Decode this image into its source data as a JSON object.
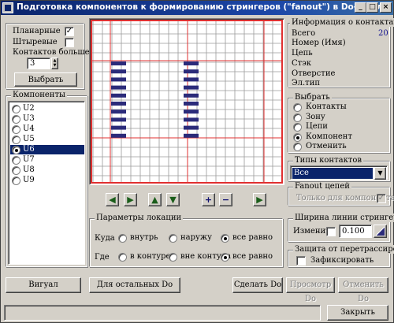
{
  "window": {
    "title": "Подготовка компонентов к формированию стрингеров (\"fanout\") в Do-файл",
    "minimize_glyph": "_",
    "maximize_glyph": "□",
    "close_glyph": "×"
  },
  "left_panel": {
    "planar_label": "Планарные",
    "planar_checked": true,
    "pin_label": "Штыревые",
    "pin_checked": false,
    "contacts_more_label": "Контактов больше",
    "contacts_more_value": "3",
    "select_button": "Выбрать",
    "components_title": "Компоненты",
    "components": [
      {
        "name": "U2",
        "selected": false
      },
      {
        "name": "U3",
        "selected": false
      },
      {
        "name": "U4",
        "selected": false
      },
      {
        "name": "U5",
        "selected": false
      },
      {
        "name": "U6",
        "selected": true
      },
      {
        "name": "U7",
        "selected": false
      },
      {
        "name": "U8",
        "selected": false
      },
      {
        "name": "U9",
        "selected": false
      }
    ]
  },
  "nav_buttons": {
    "left": "◀",
    "right": "▶",
    "up": "▲",
    "down": "▼",
    "zoom_in": "+",
    "zoom_out": "−",
    "forward": "▶"
  },
  "info": {
    "title": "Информация о контактах",
    "total_label": "Всего",
    "total_value": "20",
    "number_label": "Номер (Имя)",
    "net_label": "Цепь",
    "stack_label": "Стэк",
    "hole_label": "Отверстие",
    "layer_label": "Эл.тип"
  },
  "select_group": {
    "title": "Выбрать",
    "options": [
      {
        "label": "Контакты",
        "selected": false
      },
      {
        "label": "Зону",
        "selected": false
      },
      {
        "label": "Цепи",
        "selected": false
      },
      {
        "label": "Компонент",
        "selected": true
      },
      {
        "label": "Отменить",
        "selected": false
      }
    ]
  },
  "contact_types": {
    "title": "Типы контактов",
    "value": "Все",
    "arrow": "▼"
  },
  "fanout": {
    "title": "Fanout цепей",
    "only_component_label": "Только для компонента",
    "checked": true
  },
  "location": {
    "title": "Параметры локации",
    "where_label": "Куда",
    "where_options": [
      {
        "label": "внутрь",
        "selected": false
      },
      {
        "label": "наружу",
        "selected": false
      },
      {
        "label": "все равно",
        "selected": true
      }
    ],
    "place_label": "Где",
    "place_options": [
      {
        "label": "в контуре",
        "selected": false
      },
      {
        "label": "вне контура",
        "selected": false
      },
      {
        "label": "все равно",
        "selected": true
      }
    ]
  },
  "trace_width": {
    "title": "Ширина линии стрингера",
    "change_label": "Изменить",
    "change_checked": false,
    "value": "0.100"
  },
  "protect": {
    "title": "Защита от перетрассировки",
    "fix_label": "Зафиксировать",
    "fix_checked": false
  },
  "bottom_buttons": {
    "view": "Вигуал",
    "for_rest": "Для остальных Do",
    "make_do": "Сделать Do",
    "preview_do": "Просмотр Do",
    "cancel_do": "Отменить Do"
  },
  "status": {
    "close": "Закрыть"
  },
  "canvas": {
    "grid_color": "#9a9a9a",
    "axis_color": "#e03030",
    "pad_color": "#2b2b7a",
    "border_color": "#e03030"
  }
}
